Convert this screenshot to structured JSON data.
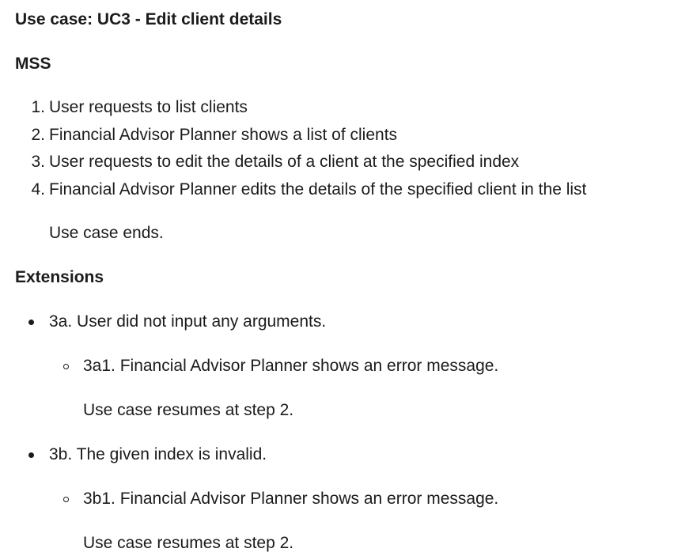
{
  "title": "Use case: UC3 - Edit client details",
  "mss": {
    "heading": "MSS",
    "steps": [
      {
        "num": "1.",
        "text": "User requests to list clients"
      },
      {
        "num": "2.",
        "text": "Financial Advisor Planner shows a list of clients"
      },
      {
        "num": "3.",
        "text": "User requests to edit the details of a client at the specified index"
      },
      {
        "num": "4.",
        "text": "Financial Advisor Planner edits the details of the specified client in the list"
      }
    ],
    "end_note": "Use case ends."
  },
  "extensions": {
    "heading": "Extensions",
    "items": [
      {
        "text": "3a. User did not input any arguments.",
        "sub": {
          "text": "3a1. Financial Advisor Planner shows an error message.",
          "note": "Use case resumes at step 2."
        }
      },
      {
        "text": "3b. The given index is invalid.",
        "sub": {
          "text": "3b1. Financial Advisor Planner shows an error message.",
          "note": "Use case resumes at step 2."
        }
      }
    ]
  }
}
